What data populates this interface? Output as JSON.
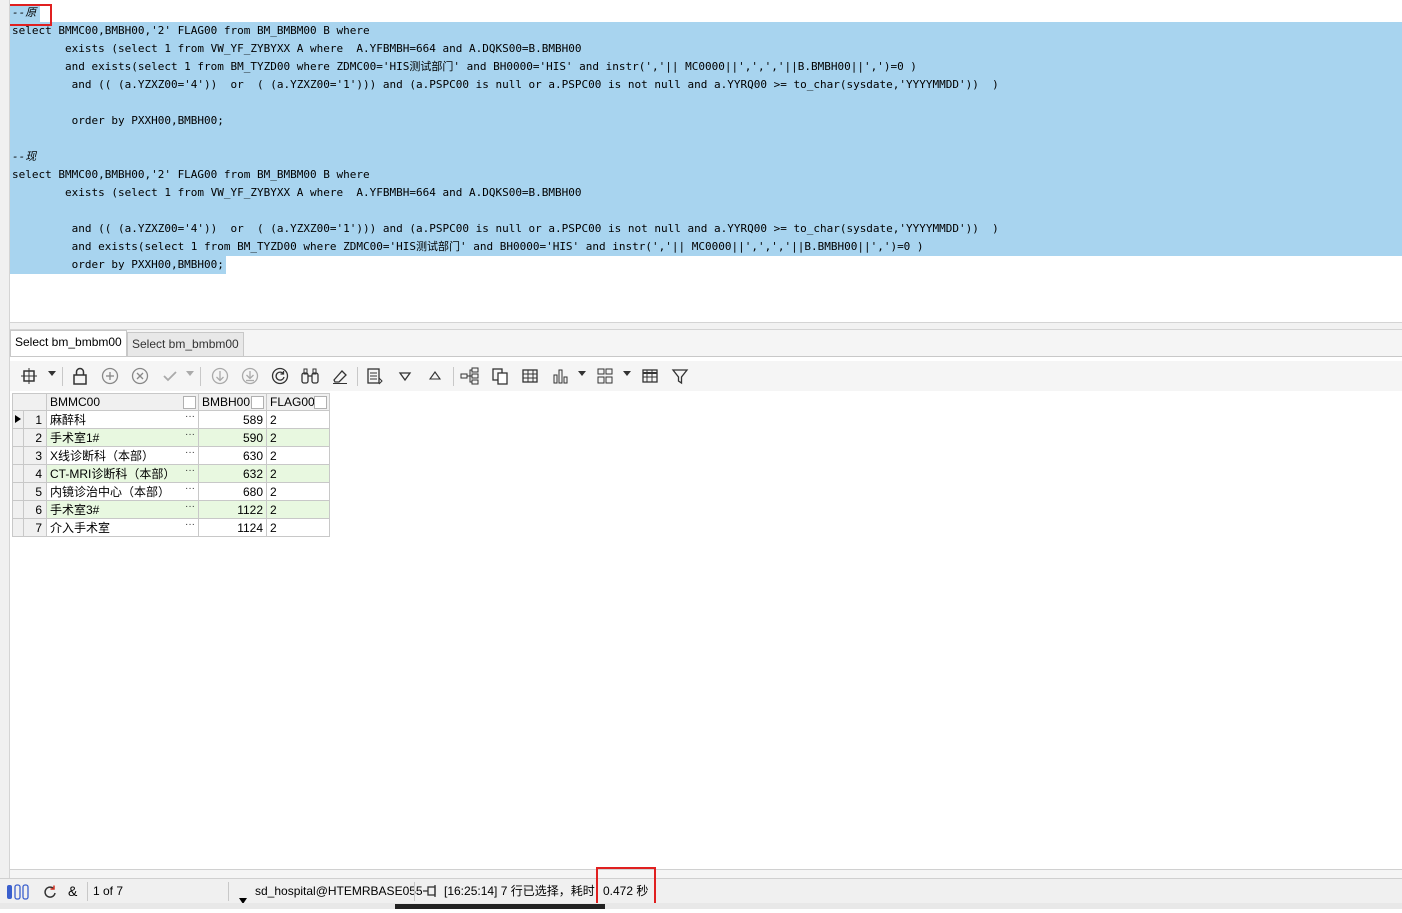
{
  "editor": {
    "lines": [
      "--原",
      "select BMMC00,BMBH00,'2' FLAG00 from BM_BMBM00 B where",
      "        exists (select 1 from VW_YF_ZYBYXX A where  A.YFBMBH=664 and A.DQKS00=B.BMBH00",
      "        and exists(select 1 from BM_TYZD00 where ZDMC00='HIS测试部门' and BH0000='HIS' and instr(','|| MC0000||',',','||B.BMBH00||',')=0 )",
      "         and (( (a.YZXZ00='4'))  or  ( (a.YZXZ00='1'))) and (a.PSPC00 is null or a.PSPC00 is not null and a.YYRQ00 >= to_char(sysdate,'YYYYMMDD'))  )",
      "",
      "         order by PXXH00,BMBH00;",
      "",
      "--现",
      "select BMMC00,BMBH00,'2' FLAG00 from BM_BMBM00 B where",
      "        exists (select 1 from VW_YF_ZYBYXX A where  A.YFBMBH=664 and A.DQKS00=B.BMBH00",
      "",
      "         and (( (a.YZXZ00='4'))  or  ( (a.YZXZ00='1'))) and (a.PSPC00 is null or a.PSPC00 is not null and a.YYRQ00 >= to_char(sysdate,'YYYYMMDD'))  )",
      "         and exists(select 1 from BM_TYZD00 where ZDMC00='HIS测试部门' and BH0000='HIS' and instr(','|| MC0000||',',','||B.BMBH00||',')=0 )",
      "         order by PXXH00,BMBH00;"
    ]
  },
  "tabs": [
    {
      "label": "Select bm_bmbm00",
      "active": true
    },
    {
      "label": "Select bm_bmbm00",
      "active": false
    }
  ],
  "grid": {
    "columns": [
      "BMMC00",
      "BMBH00",
      "FLAG00"
    ],
    "rows": [
      {
        "num": "1",
        "bmmc00": "麻醉科",
        "bmbh00": "589",
        "flag00": "2"
      },
      {
        "num": "2",
        "bmmc00": "手术室1#",
        "bmbh00": "590",
        "flag00": "2"
      },
      {
        "num": "3",
        "bmmc00": "X线诊断科（本部）",
        "bmbh00": "630",
        "flag00": "2"
      },
      {
        "num": "4",
        "bmmc00": "CT-MRI诊断科（本部）",
        "bmbh00": "632",
        "flag00": "2"
      },
      {
        "num": "5",
        "bmmc00": "内镜诊治中心（本部）",
        "bmbh00": "680",
        "flag00": "2"
      },
      {
        "num": "6",
        "bmmc00": "手术室3#",
        "bmbh00": "1122",
        "flag00": "2"
      },
      {
        "num": "7",
        "bmmc00": "介入手术室",
        "bmbh00": "1124",
        "flag00": "2"
      }
    ],
    "ellipsis": "···"
  },
  "statusbar": {
    "record_position": "1 of 7",
    "connection": "sd_hospital@HTEMRBASE055",
    "message_prefix": "[16:25:14] 7 行已选择，耗时",
    "elapsed": "0.472 秒"
  },
  "icons": {
    "toolbar": [
      "record-nav-icon",
      "lock-icon",
      "add-record-icon",
      "delete-record-icon",
      "post-icon",
      "cancel-icon",
      "fetch-next-icon",
      "fetch-all-icon",
      "refresh-icon",
      "find-icon",
      "clear-icon",
      "export-icon",
      "sort-desc-icon",
      "sort-asc-icon",
      "tree-icon",
      "copy-icon",
      "table-icon",
      "chart-icon",
      "layout-icon",
      "grid-icon",
      "filter-icon"
    ]
  },
  "colors": {
    "selection": "#a8d4ef",
    "even_row": "#e8f8e0",
    "highlight_box": "#e02020"
  }
}
